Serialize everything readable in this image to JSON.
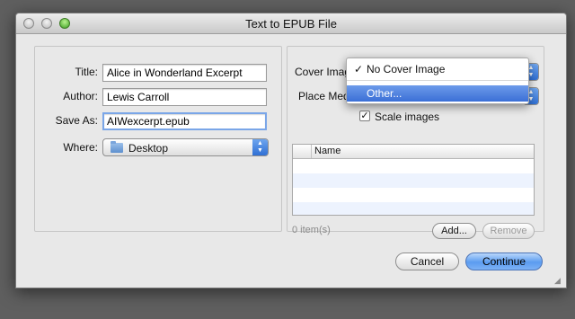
{
  "window": {
    "title": "Text to EPUB File"
  },
  "form": {
    "title_label": "Title:",
    "title_value": "Alice in Wonderland Excerpt",
    "author_label": "Author:",
    "author_value": "Lewis Carroll",
    "saveas_label": "Save As:",
    "saveas_value": "AIWexcerpt.epub",
    "where_label": "Where:",
    "where_value": "Desktop"
  },
  "right": {
    "cover_label": "Cover Imag",
    "place_label": "Place Medi",
    "scale_label": "Scale images",
    "scale_checked": true,
    "table_header": "Name",
    "item_count": "0 item(s)",
    "add_label": "Add...",
    "remove_label": "Remove"
  },
  "menu": {
    "items": [
      {
        "label": "No Cover Image",
        "checked": true,
        "highlighted": false
      },
      {
        "label": "Other...",
        "checked": false,
        "highlighted": true
      }
    ],
    "check_glyph": "✓"
  },
  "footer": {
    "cancel_label": "Cancel",
    "continue_label": "Continue"
  },
  "icons": {
    "folder": "folder-icon",
    "popup_arrows": "updown-arrows-icon",
    "check": "checkmark-icon",
    "resize": "resize-grip-icon"
  },
  "colors": {
    "accent": "#3b6fd6",
    "default_button": "#5b9cf0",
    "focus_ring": "#7aa6e8",
    "table_stripe": "#edf3fe"
  }
}
